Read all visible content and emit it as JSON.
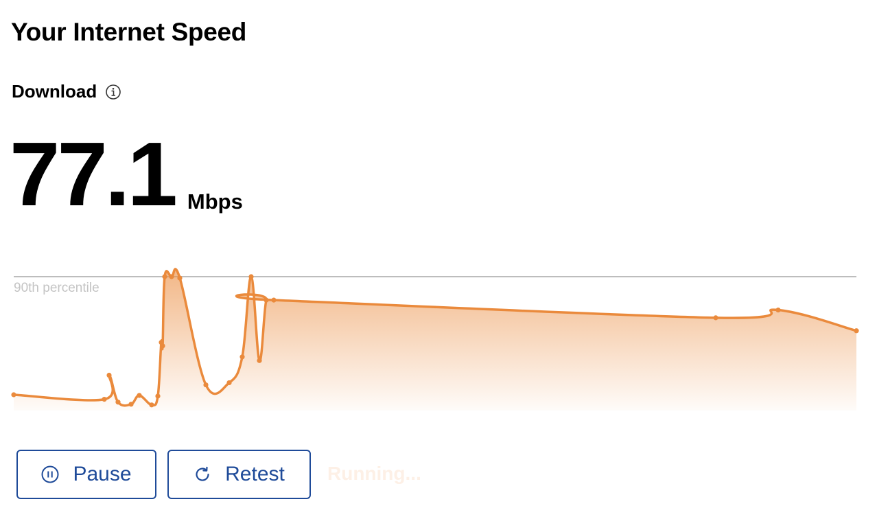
{
  "page": {
    "title": "Your Internet Speed",
    "download_label": "Download",
    "speed_value": "77.1",
    "speed_unit": "Mbps",
    "status_text": "Running..."
  },
  "buttons": {
    "pause_label": "Pause",
    "retest_label": "Retest"
  },
  "colors": {
    "accent": "#ea8a3c",
    "button": "#1f4b99",
    "reference_line": "#bdbdbd",
    "reference_label": "#c4c4c4"
  },
  "icons": {
    "info": "info-icon",
    "pause": "pause-icon",
    "retest": "retest-icon"
  },
  "chart_data": {
    "type": "area",
    "reference_line": {
      "label": "90th percentile",
      "value": 1.0
    },
    "x": [
      0,
      132,
      139,
      152,
      171,
      183,
      201,
      210,
      215,
      217,
      220,
      230,
      242,
      280,
      314,
      333,
      346,
      358,
      368,
      379,
      1023,
      1114,
      1228
    ],
    "values": [
      0.118,
      0.084,
      0.264,
      0.063,
      0.047,
      0.113,
      0.042,
      0.108,
      0.509,
      0.483,
      1.0,
      1.0,
      0.99,
      0.192,
      0.208,
      0.401,
      1.0,
      0.373,
      0.825,
      0.825,
      0.693,
      0.751,
      0.596
    ],
    "ylim": [
      0,
      1.0
    ]
  }
}
